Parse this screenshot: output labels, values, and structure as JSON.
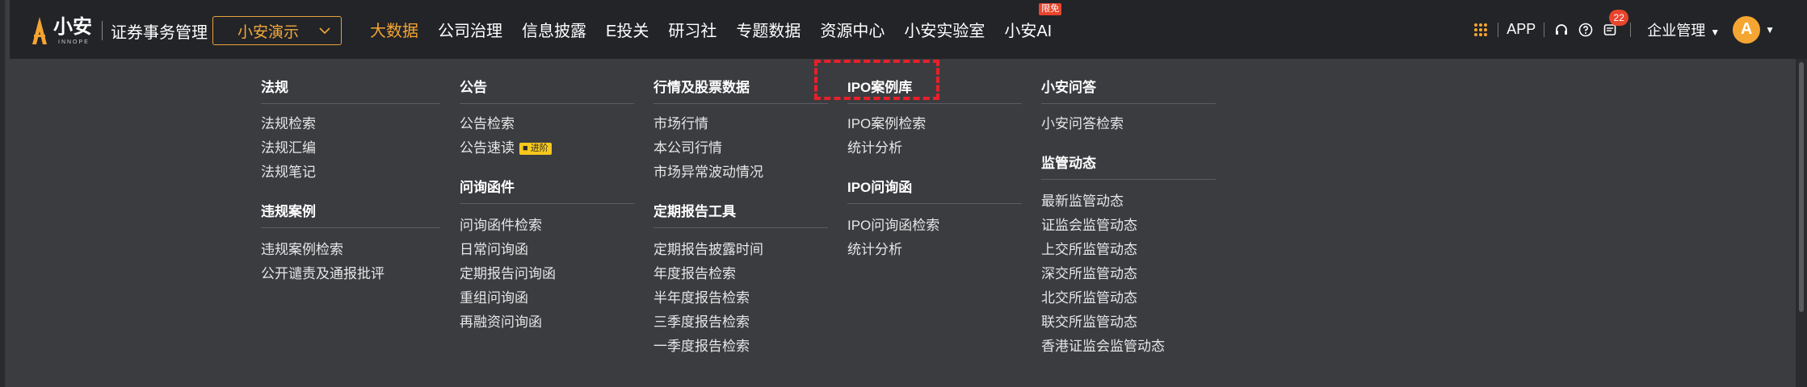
{
  "brand": {
    "name": "小安",
    "sub": "INNOPE",
    "subtitle": "证券事务管理"
  },
  "tenant": {
    "value": "小安演示"
  },
  "nav": [
    {
      "label": "大数据",
      "active": true
    },
    {
      "label": "公司治理"
    },
    {
      "label": "信息披露"
    },
    {
      "label": "E投关"
    },
    {
      "label": "研习社"
    },
    {
      "label": "专题数据"
    },
    {
      "label": "资源中心"
    },
    {
      "label": "小安实验室"
    },
    {
      "label": "小安AI",
      "badge": "限免"
    }
  ],
  "tools": {
    "app": "APP",
    "message_count": "22",
    "corp": "企业管理",
    "avatar_initial": "A"
  },
  "menu": {
    "col1": {
      "s1": {
        "title": "法规",
        "links": [
          "法规检索",
          "法规汇编",
          "法规笔记"
        ]
      },
      "s2": {
        "title": "违规案例",
        "links": [
          "违规案例检索",
          "公开谴责及通报批评"
        ]
      }
    },
    "col2": {
      "s1": {
        "title": "公告",
        "links": [
          "公告检索",
          "公告速读"
        ],
        "tag": "进阶"
      },
      "s2": {
        "title": "问询函件",
        "links": [
          "问询函件检索",
          "日常问询函",
          "定期报告问询函",
          "重组问询函",
          "再融资问询函"
        ]
      }
    },
    "col3": {
      "s1": {
        "title": "行情及股票数据",
        "links": [
          "市场行情",
          "本公司行情",
          "市场异常波动情况"
        ]
      },
      "s2": {
        "title": "定期报告工具",
        "links": [
          "定期报告披露时间",
          "年度报告检索",
          "半年度报告检索",
          "三季度报告检索",
          "一季度报告检索"
        ]
      }
    },
    "col4": {
      "s1": {
        "title": "IPO案例库",
        "links": [
          "IPO案例检索",
          "统计分析"
        ]
      },
      "s2": {
        "title": "IPO问询函",
        "links": [
          "IPO问询函检索",
          "统计分析"
        ]
      }
    },
    "col5": {
      "s1": {
        "title": "小安问答",
        "links": [
          "小安问答检索"
        ]
      },
      "s2": {
        "title": "监管动态",
        "links": [
          "最新监管动态",
          "证监会监管动态",
          "上交所监管动态",
          "深交所监管动态",
          "北交所监管动态",
          "联交所监管动态",
          "香港证监会监管动态"
        ]
      }
    }
  },
  "colors": {
    "accent": "#f5a531",
    "header_bg": "#232428",
    "menu_bg": "#3b3c40",
    "highlight": "#e8202a"
  }
}
